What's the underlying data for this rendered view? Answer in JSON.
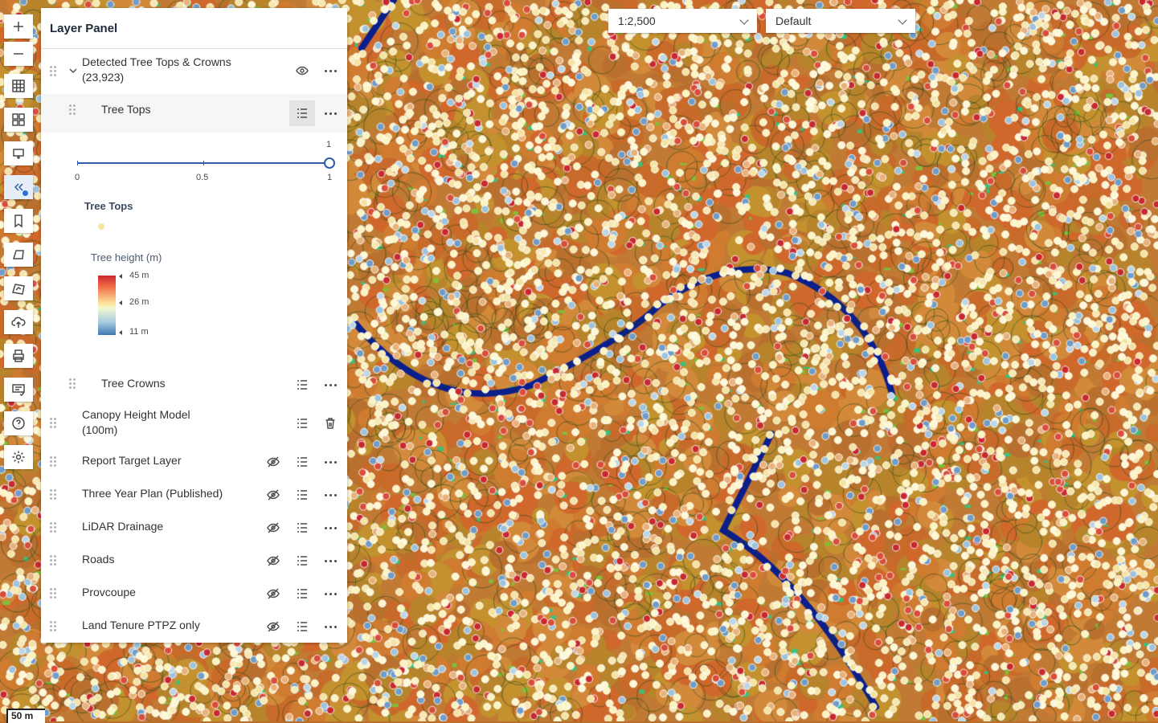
{
  "toolbar": {
    "buttons": [
      {
        "icon": "zoom-in-icon"
      },
      {
        "icon": "zoom-out-icon"
      },
      {
        "icon": "basemap-grid-icon"
      },
      {
        "icon": "layer-list-icon"
      },
      {
        "icon": "add-layer-icon"
      },
      {
        "icon": "collapse-icon"
      },
      {
        "icon": "bookmark-icon"
      },
      {
        "icon": "sketch-icon"
      },
      {
        "icon": "measure-icon"
      },
      {
        "icon": "upload-icon"
      },
      {
        "icon": "print-icon"
      },
      {
        "icon": "report-icon"
      },
      {
        "icon": "help-icon"
      },
      {
        "icon": "settings-icon"
      }
    ]
  },
  "panel": {
    "title": "Layer Panel",
    "group": {
      "label_line1": "Detected Tree Tops & Crowns",
      "label_line2": "(23,923)",
      "sublayers": [
        {
          "label": "Tree Tops"
        },
        {
          "label": "Tree Crowns"
        }
      ]
    },
    "slider": {
      "min_label": "0",
      "mid_label": "0.5",
      "max_label": "1",
      "value_label": "1",
      "value": 1
    },
    "legend": {
      "layer_title": "Tree Tops",
      "field_title": "Tree height (m)",
      "stops": [
        "45 m",
        "26 m",
        "11 m"
      ],
      "symbol_color": "#f5e3a2"
    },
    "layers": [
      {
        "label_line1": "Canopy Height Model",
        "label_line2": "(100m)"
      },
      {
        "label": "Report Target Layer"
      },
      {
        "label": "Three Year Plan (Published)"
      },
      {
        "label": "LiDAR Drainage"
      },
      {
        "label": "Roads"
      },
      {
        "label": "Provcoupe"
      },
      {
        "label": "Land Tenure PTPZ only"
      }
    ]
  },
  "scale_select": {
    "value": "1:2,500"
  },
  "style_select": {
    "value": "Default"
  },
  "scalebar": {
    "label": "50 m"
  },
  "colors": {
    "accent": "#2e5fa8",
    "title": "#1e2a3a"
  }
}
